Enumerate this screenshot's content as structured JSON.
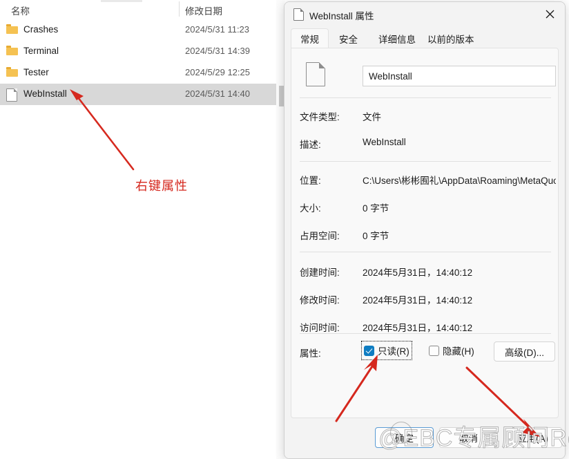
{
  "explorer": {
    "columns": {
      "name": "名称",
      "date": "修改日期"
    },
    "rows": [
      {
        "icon": "folder-icon",
        "name": "Crashes",
        "date": "2024/5/31 11:23",
        "selected": false
      },
      {
        "icon": "folder-icon",
        "name": "Terminal",
        "date": "2024/5/31 14:39",
        "selected": false
      },
      {
        "icon": "folder-icon",
        "name": "Tester",
        "date": "2024/5/29 12:25",
        "selected": false
      },
      {
        "icon": "document-icon",
        "name": "WebInstall",
        "date": "2024/5/31 14:40",
        "selected": true
      }
    ]
  },
  "annotations": {
    "left_note": "右键属性",
    "color": "#d5281e"
  },
  "dialog": {
    "title": "WebInstall 属性",
    "title_icon": "document-icon",
    "close_icon": "close-icon",
    "tabs": [
      {
        "label": "常规",
        "active": true
      },
      {
        "label": "安全",
        "active": false
      },
      {
        "label": "详细信息",
        "active": false
      },
      {
        "label": "以前的版本",
        "active": false
      }
    ],
    "file_icon": "document-icon",
    "name_value": "WebInstall",
    "properties": [
      {
        "label": "文件类型:",
        "value": "文件"
      },
      {
        "label": "描述:",
        "value": "WebInstall"
      },
      {
        "label": "位置:",
        "value": "C:\\Users\\彬彬囿礼\\AppData\\Roaming\\MetaQuote"
      },
      {
        "label": "大小:",
        "value": "0 字节"
      },
      {
        "label": "占用空间:",
        "value": "0 字节"
      },
      {
        "label": "创建时间:",
        "value": "2024年5月31日，14:40:12"
      },
      {
        "label": "修改时间:",
        "value": "2024年5月31日，14:40:12"
      },
      {
        "label": "访问时间:",
        "value": "2024年5月31日，14:40:12"
      }
    ],
    "attributes": {
      "label": "属性:",
      "readonly": {
        "label": "只读(R)",
        "checked": true,
        "focused": true
      },
      "hidden": {
        "label": "隐藏(H)",
        "checked": false,
        "focused": false
      },
      "advanced_button": "高级(D)..."
    },
    "footer": {
      "ok": "确定",
      "cancel": "取消",
      "apply": "应用(A)"
    },
    "accent_color": "#0f7dc2"
  },
  "watermark": {
    "text": "@EBC专属顾问Robin"
  }
}
